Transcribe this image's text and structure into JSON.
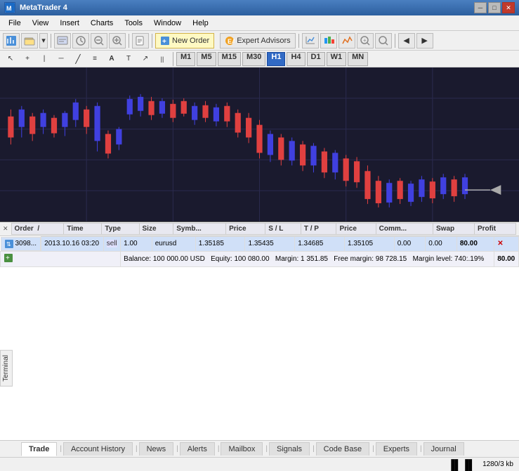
{
  "titlebar": {
    "title": "MetaTrader 4",
    "icon": "MT4"
  },
  "menubar": {
    "items": [
      "File",
      "View",
      "Insert",
      "Charts",
      "Tools",
      "Window",
      "Help"
    ]
  },
  "toolbar1": {
    "new_order_label": "New Order",
    "expert_advisors_label": "Expert Advisors"
  },
  "timeframes": [
    "M1",
    "M5",
    "M15",
    "M30",
    "H1",
    "H4",
    "D1",
    "W1",
    "MN"
  ],
  "active_timeframe": "H1",
  "table": {
    "headers": [
      "Order",
      "/",
      "Time",
      "Type",
      "Size",
      "Symb...",
      "Price",
      "S / L",
      "T / P",
      "Price",
      "Comm...",
      "Swap",
      "Profit"
    ],
    "rows": [
      {
        "order": "3098...",
        "time": "2013.10.16 03:20",
        "type": "sell",
        "size": "1.00",
        "symbol": "eurusd",
        "open_price": "1.35185",
        "sl": "1.35435",
        "tp": "1.34685",
        "current_price": "1.35105",
        "commission": "0.00",
        "swap": "0.00",
        "profit": "80.00"
      }
    ],
    "balance_row": {
      "balance": "Balance: 100 000.00 USD",
      "equity": "Equity: 100 080.00",
      "margin": "Margin: 1 351.85",
      "free_margin": "Free margin: 98 728.15",
      "margin_level": "Margin level: 740:.19%",
      "profit": "80.00"
    }
  },
  "tabs": {
    "items": [
      "Trade",
      "Account History",
      "News",
      "Alerts",
      "Mailbox",
      "Signals",
      "Code Base",
      "Experts",
      "Journal"
    ],
    "active": "Trade"
  },
  "statusbar": {
    "memory": "1280/3 kb"
  },
  "sidebar": {
    "terminal_label": "Terminal"
  }
}
